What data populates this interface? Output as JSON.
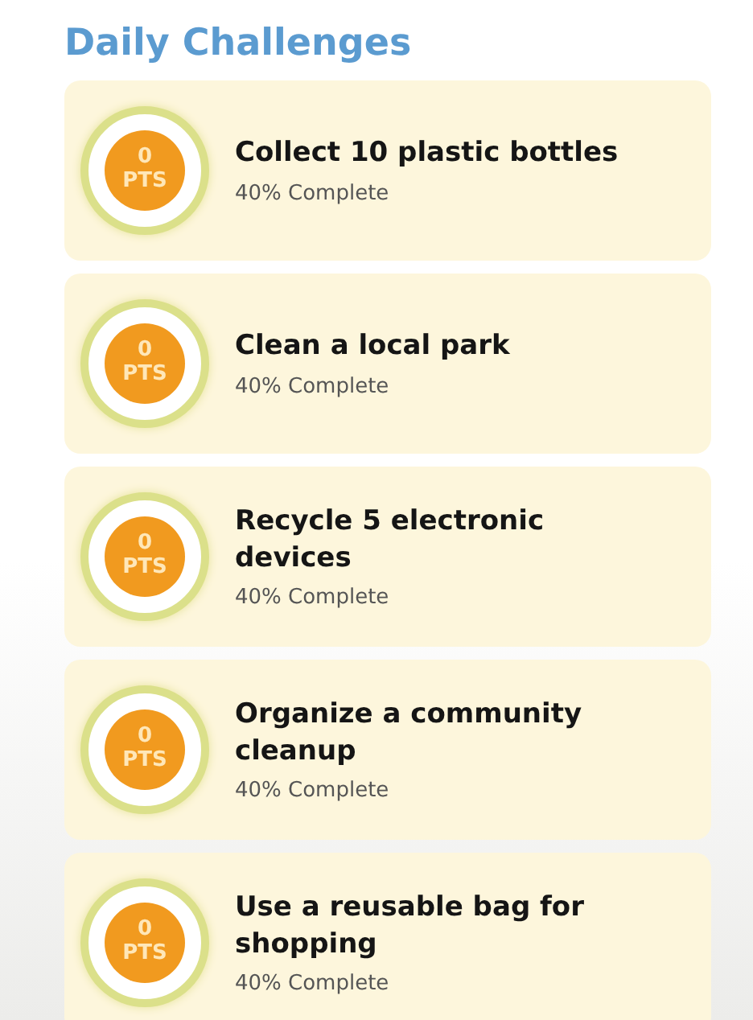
{
  "section_title": "Daily Challenges",
  "challenges": [
    {
      "points": "0",
      "unit": "PTS",
      "title": "Collect 10 plastic bottles",
      "progress": "40% Complete"
    },
    {
      "points": "0",
      "unit": "PTS",
      "title": "Clean a local park",
      "progress": "40% Complete"
    },
    {
      "points": "0",
      "unit": "PTS",
      "title": "Recycle 5 electronic devices",
      "progress": "40% Complete"
    },
    {
      "points": "0",
      "unit": "PTS",
      "title": "Organize a community cleanup",
      "progress": "40% Complete"
    },
    {
      "points": "0",
      "unit": "PTS",
      "title": "Use a reusable bag for shopping",
      "progress": "40% Complete"
    }
  ]
}
